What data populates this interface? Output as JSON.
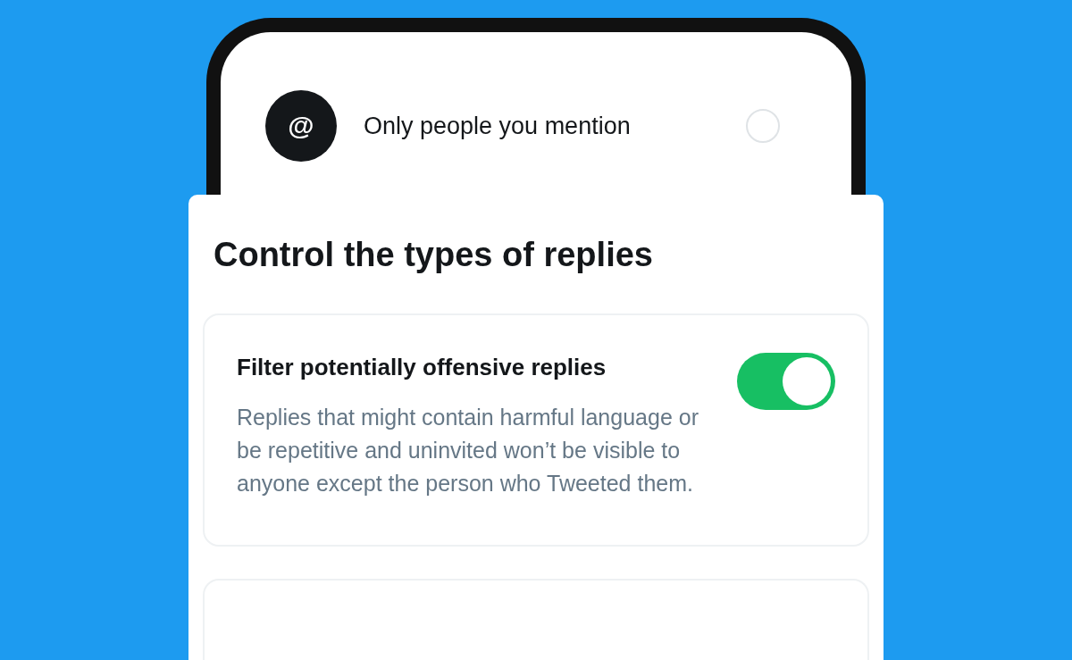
{
  "phone_screen": {
    "option": {
      "icon": "@",
      "label": "Only people you mention",
      "selected": false
    }
  },
  "sheet": {
    "title": "Control the types of replies",
    "settings": [
      {
        "title": "Filter potentially offensive replies",
        "description": "Replies that might contain harmful language or be repetitive and uninvited won’t be visible to anyone except the person who Tweeted them.",
        "on": true
      }
    ]
  }
}
